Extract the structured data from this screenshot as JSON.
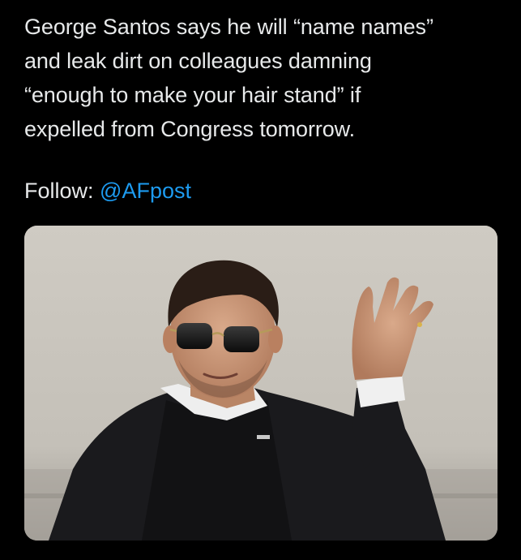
{
  "tweet": {
    "text_lines": [
      "George Santos says he will “name names”",
      "and leak dirt on colleagues damning",
      "“enough to make your hair stand” if",
      "expelled from Congress tomorrow."
    ],
    "follow_label": "Follow:",
    "mention": "@AFpost",
    "colors": {
      "text": "#e7e9ea",
      "link": "#1d9bf0",
      "background": "#000000"
    },
    "media": {
      "type": "photo",
      "icon": "photo-of-man-in-sunglasses-waving"
    }
  }
}
